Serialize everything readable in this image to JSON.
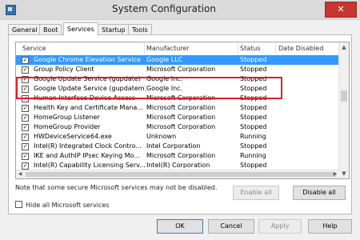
{
  "window": {
    "title": "System Configuration",
    "close_label": "✕"
  },
  "tabs": [
    {
      "label": "General"
    },
    {
      "label": "Boot"
    },
    {
      "label": "Services",
      "active": true
    },
    {
      "label": "Startup"
    },
    {
      "label": "Tools"
    }
  ],
  "list": {
    "columns": {
      "service": "Service",
      "manufacturer": "Manufacturer",
      "status": "Status",
      "date_disabled": "Date Disabled"
    },
    "rows": [
      {
        "checked": true,
        "service": "Google Chrome Elevation Service",
        "manufacturer": "Google LLC",
        "status": "Stopped",
        "date_disabled": ""
      },
      {
        "checked": true,
        "service": "Group Policy Client",
        "manufacturer": "Microsoft Corporation",
        "status": "Stopped",
        "date_disabled": ""
      },
      {
        "checked": true,
        "service": "Google Update Service (gupdate)",
        "manufacturer": "Google Inc.",
        "status": "Stopped",
        "date_disabled": ""
      },
      {
        "checked": true,
        "service": "Google Update Service (gupdatem)",
        "manufacturer": "Google Inc.",
        "status": "Stopped",
        "date_disabled": ""
      },
      {
        "checked": true,
        "service": "Human Interface Device Access",
        "manufacturer": "Microsoft Corporation",
        "status": "Stopped",
        "date_disabled": ""
      },
      {
        "checked": true,
        "service": "Health Key and Certificate Mana...",
        "manufacturer": "Microsoft Corporation",
        "status": "Stopped",
        "date_disabled": ""
      },
      {
        "checked": true,
        "service": "HomeGroup Listener",
        "manufacturer": "Microsoft Corporation",
        "status": "Stopped",
        "date_disabled": ""
      },
      {
        "checked": true,
        "service": "HomeGroup Provider",
        "manufacturer": "Microsoft Corporation",
        "status": "Stopped",
        "date_disabled": ""
      },
      {
        "checked": true,
        "service": "HWDeviceService64.exe",
        "manufacturer": "Unknown",
        "status": "Running",
        "date_disabled": ""
      },
      {
        "checked": true,
        "service": "Intel(R) Integrated Clock Contro...",
        "manufacturer": "Intel Corporation",
        "status": "Stopped",
        "date_disabled": ""
      },
      {
        "checked": true,
        "service": "IKE and AuthIP IPsec Keying Mo...",
        "manufacturer": "Microsoft Corporation",
        "status": "Running",
        "date_disabled": ""
      },
      {
        "checked": true,
        "service": "Intel(R) Capability Licensing Serv...",
        "manufacturer": "Intel(R) Corporation",
        "status": "Stopped",
        "date_disabled": ""
      }
    ],
    "selected_row": 0
  },
  "note": "Note that some secure Microsoft services may not be disabled.",
  "buttons": {
    "enable_all": "Enable all",
    "disable_all": "Disable all",
    "ok": "OK",
    "cancel": "Cancel",
    "apply": "Apply",
    "help": "Help"
  },
  "hide_ms": {
    "label": "Hide all Microsoft services",
    "checked": false
  },
  "colors": {
    "selection": "#3399ff",
    "highlight_box": "#e51c23"
  }
}
